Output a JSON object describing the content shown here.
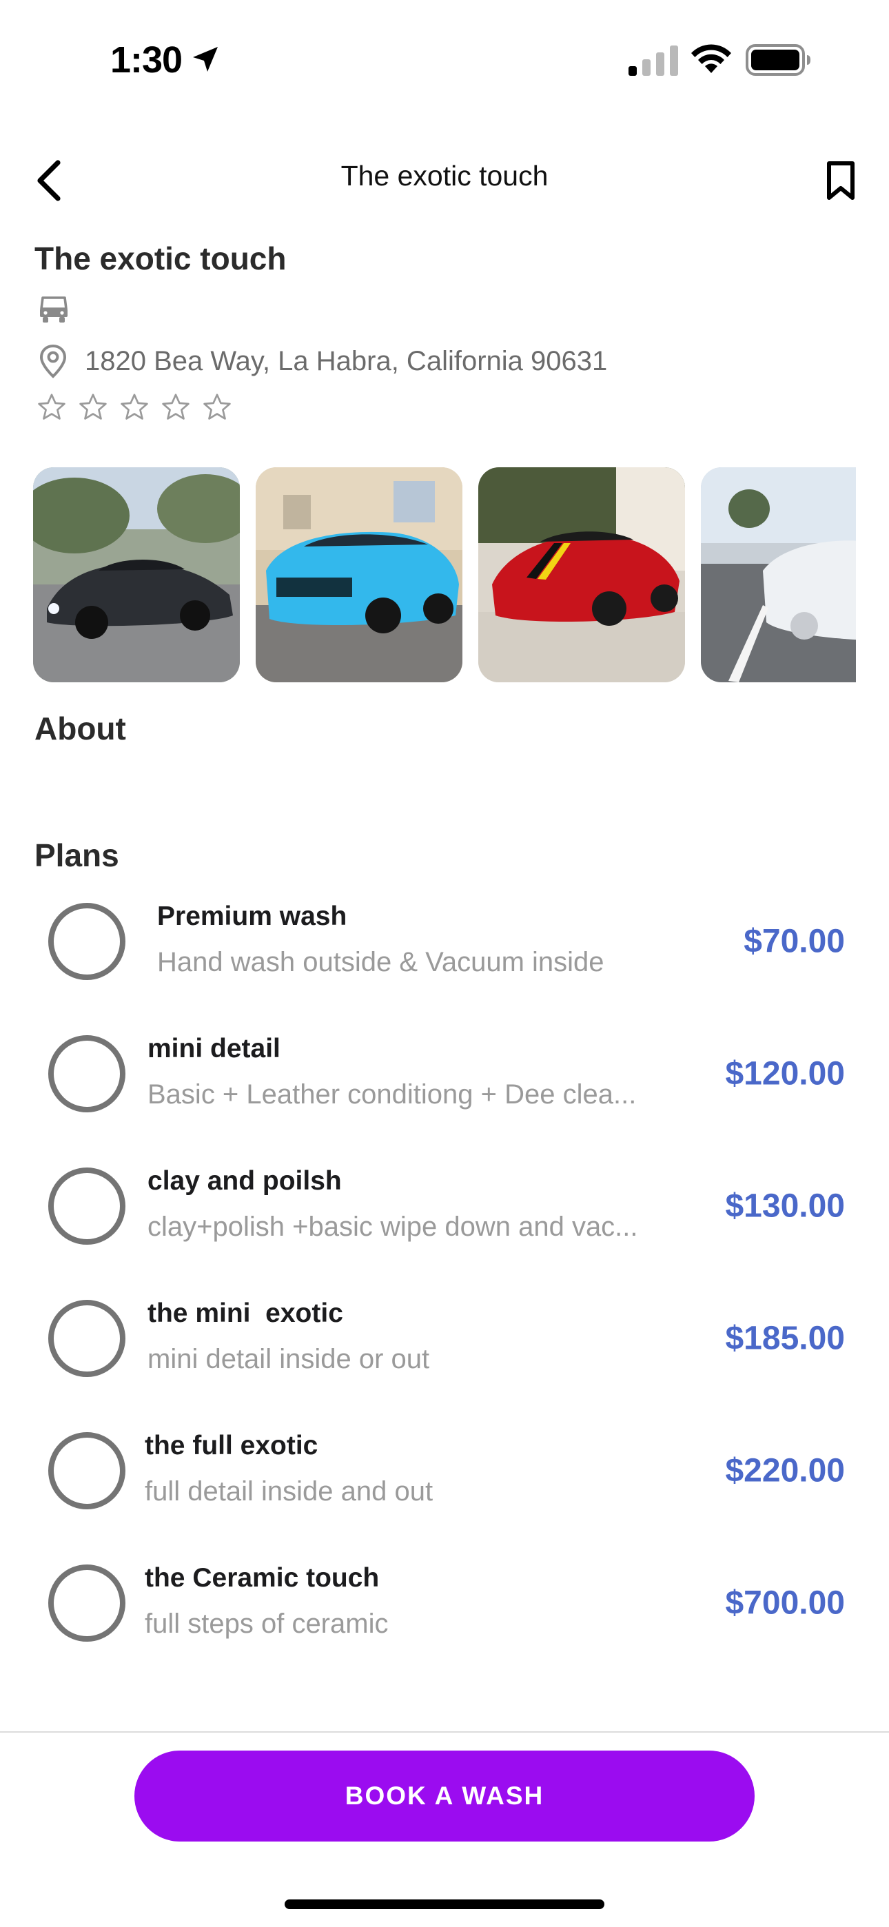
{
  "status_bar": {
    "time": "1:30",
    "icons": [
      "location-arrow-icon",
      "cellular-signal-icon",
      "wifi-icon",
      "battery-icon"
    ]
  },
  "nav": {
    "title": "The exotic touch",
    "back_icon": "chevron-left-icon",
    "bookmark_icon": "bookmark-icon"
  },
  "shop": {
    "name": "The exotic touch",
    "vehicle_icon": "car-icon",
    "address": "1820 Bea Way, La Habra, California 90631",
    "rating": 0,
    "rating_max": 5
  },
  "gallery": [
    {
      "name": "black-supercar-photo",
      "color": "#3a3d42"
    },
    {
      "name": "blue-suv-photo",
      "color": "#33b8ec"
    },
    {
      "name": "red-sports-car-photo",
      "color": "#c8141c"
    },
    {
      "name": "white-sedan-photo",
      "color": "#e9ecef"
    }
  ],
  "sections": {
    "about": "About",
    "plans": "Plans"
  },
  "plans": [
    {
      "name": "Premium wash",
      "description": "Hand wash outside & Vacuum inside",
      "price": "$70.00"
    },
    {
      "name": "mini detail",
      "description": "Basic + Leather conditiong + Dee clea...",
      "price": "$120.00"
    },
    {
      "name": "clay and poilsh",
      "description": "clay+polish +basic wipe down and vac...",
      "price": "$130.00"
    },
    {
      "name": "the mini  exotic",
      "description": "mini detail inside or out",
      "price": "$185.00"
    },
    {
      "name": "the full exotic",
      "description": "full detail inside and out",
      "price": "$220.00"
    },
    {
      "name": "the Ceramic touch",
      "description": "full steps of ceramic",
      "price": "$700.00"
    }
  ],
  "cta": {
    "label": "BOOK A WASH",
    "color": "#9b0cf0"
  },
  "colors": {
    "price": "#4a68c9",
    "radio": "#747474"
  }
}
